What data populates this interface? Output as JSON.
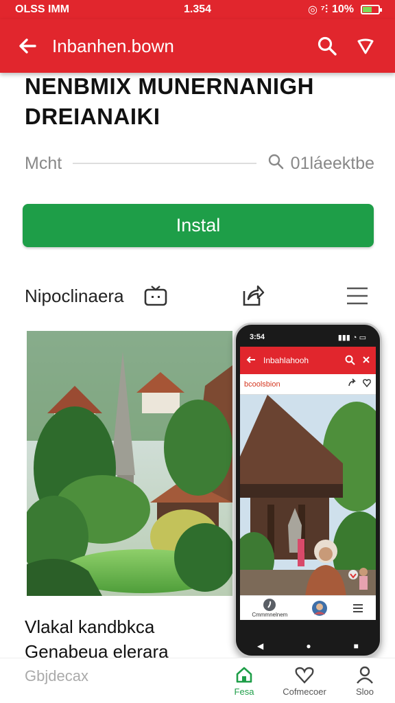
{
  "status": {
    "left": "OLSS IMM",
    "time": "1.354",
    "right": "10%",
    "battery_level": 0.6
  },
  "appbar": {
    "title": "Inbanhen.bown",
    "back_icon": "arrow-left-icon",
    "search_icon": "search-icon",
    "menu_icon": "chevron-down-icon"
  },
  "headline": {
    "line1": "NENBMIX MUNERNANIGH",
    "line2": "DREIANAIKI"
  },
  "meta": {
    "left": "Mcht",
    "right": "01láeektbe"
  },
  "install": {
    "label": "Instal"
  },
  "section": {
    "label": "Nipoclinaera",
    "tv_icon": "tv-icon",
    "share_icon": "share-icon",
    "menu_icon": "hamburger-icon"
  },
  "phone": {
    "status_left": "3:54",
    "title": "Inbahlahooh",
    "subtitle": "bcoolsbion"
  },
  "caption": {
    "line1": "Vlakal kandbkca",
    "line2": "Genabeua elerara"
  },
  "bottom": {
    "hint": "Gbjdecax",
    "items": [
      {
        "label": "Fesa",
        "icon": "home-icon"
      },
      {
        "label": "Cofmecoer",
        "icon": "heart-icon"
      },
      {
        "label": "Sloo",
        "icon": "profile-icon"
      }
    ]
  },
  "colors": {
    "brand_red": "#e1262d",
    "install_green": "#1e9e48"
  }
}
